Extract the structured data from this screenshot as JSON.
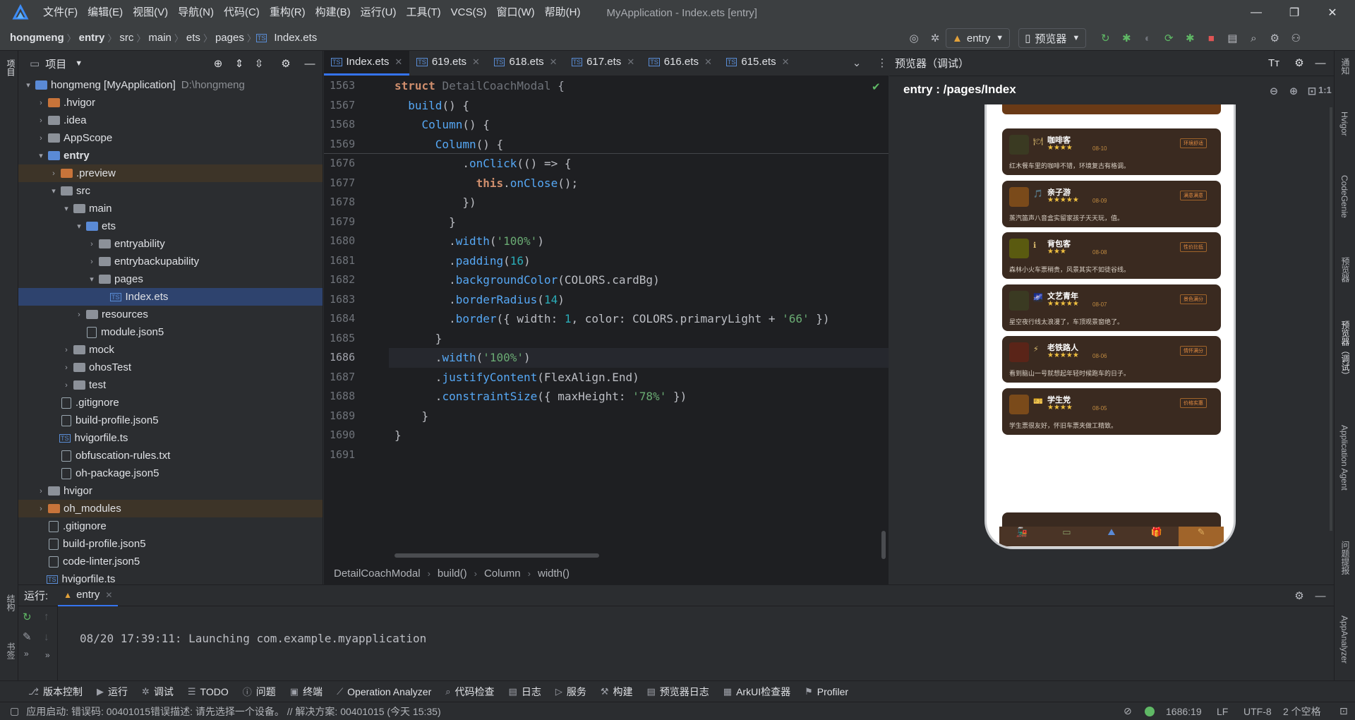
{
  "app": {
    "window_title": "MyApplication - Index.ets [entry]"
  },
  "menu": [
    "文件(F)",
    "编辑(E)",
    "视图(V)",
    "导航(N)",
    "代码(C)",
    "重构(R)",
    "构建(B)",
    "运行(U)",
    "工具(T)",
    "VCS(S)",
    "窗口(W)",
    "帮助(H)"
  ],
  "breadcrumb": [
    "hongmeng",
    "entry",
    "src",
    "main",
    "ets",
    "pages",
    "Index.ets"
  ],
  "toolbar": {
    "run_config": "entry",
    "previewer": "预览器"
  },
  "project_panel": {
    "title": "项目",
    "tree": [
      {
        "label": "hongmeng [MyApplication]",
        "extra": "D:\\hongmeng",
        "depth": 0,
        "arrow": "▾",
        "kind": "folder-blue"
      },
      {
        "label": ".hvigor",
        "depth": 1,
        "arrow": "›",
        "kind": "folder-orange"
      },
      {
        "label": ".idea",
        "depth": 1,
        "arrow": "›",
        "kind": "folder-gray"
      },
      {
        "label": "AppScope",
        "depth": 1,
        "arrow": "›",
        "kind": "folder-gray"
      },
      {
        "label": "entry",
        "depth": 1,
        "arrow": "▾",
        "kind": "folder-blue",
        "bold": true
      },
      {
        "label": ".preview",
        "depth": 2,
        "arrow": "›",
        "kind": "folder-orange",
        "hl": true
      },
      {
        "label": "src",
        "depth": 2,
        "arrow": "▾",
        "kind": "folder-gray"
      },
      {
        "label": "main",
        "depth": 3,
        "arrow": "▾",
        "kind": "folder-gray"
      },
      {
        "label": "ets",
        "depth": 4,
        "arrow": "▾",
        "kind": "folder-blue"
      },
      {
        "label": "entryability",
        "depth": 5,
        "arrow": "›",
        "kind": "folder-gray"
      },
      {
        "label": "entrybackupability",
        "depth": 5,
        "arrow": "›",
        "kind": "folder-gray"
      },
      {
        "label": "pages",
        "depth": 5,
        "arrow": "▾",
        "kind": "folder-gray"
      },
      {
        "label": "Index.ets",
        "depth": 6,
        "arrow": "",
        "kind": "file-ets",
        "selected": true
      },
      {
        "label": "resources",
        "depth": 4,
        "arrow": "›",
        "kind": "folder-gray"
      },
      {
        "label": "module.json5",
        "depth": 4,
        "arrow": "",
        "kind": "file"
      },
      {
        "label": "mock",
        "depth": 3,
        "arrow": "›",
        "kind": "folder-gray"
      },
      {
        "label": "ohosTest",
        "depth": 3,
        "arrow": "›",
        "kind": "folder-gray"
      },
      {
        "label": "test",
        "depth": 3,
        "arrow": "›",
        "kind": "folder-gray"
      },
      {
        "label": ".gitignore",
        "depth": 2,
        "arrow": "",
        "kind": "file"
      },
      {
        "label": "build-profile.json5",
        "depth": 2,
        "arrow": "",
        "kind": "file"
      },
      {
        "label": "hvigorfile.ts",
        "depth": 2,
        "arrow": "",
        "kind": "file-ts"
      },
      {
        "label": "obfuscation-rules.txt",
        "depth": 2,
        "arrow": "",
        "kind": "file"
      },
      {
        "label": "oh-package.json5",
        "depth": 2,
        "arrow": "",
        "kind": "file"
      },
      {
        "label": "hvigor",
        "depth": 1,
        "arrow": "›",
        "kind": "folder-gray"
      },
      {
        "label": "oh_modules",
        "depth": 1,
        "arrow": "›",
        "kind": "folder-orange",
        "hl": true
      },
      {
        "label": ".gitignore",
        "depth": 1,
        "arrow": "",
        "kind": "file"
      },
      {
        "label": "build-profile.json5",
        "depth": 1,
        "arrow": "",
        "kind": "file"
      },
      {
        "label": "code-linter.json5",
        "depth": 1,
        "arrow": "",
        "kind": "file"
      },
      {
        "label": "hvigorfile.ts",
        "depth": 1,
        "arrow": "",
        "kind": "file-ts"
      }
    ]
  },
  "tabs": [
    "Index.ets",
    "619.ets",
    "618.ets",
    "617.ets",
    "616.ets",
    "615.ets"
  ],
  "editor": {
    "line_numbers": [
      "1563",
      "1567",
      "1568",
      "1569",
      "1676",
      "1677",
      "1678",
      "1679",
      "1680",
      "1681",
      "1682",
      "1683",
      "1684",
      "1685",
      "1686",
      "1687",
      "1688",
      "1689",
      "1690",
      "1691"
    ],
    "current_line": "1686",
    "breadcrumb": [
      "DetailCoachModal",
      "build()",
      "Column",
      "width()"
    ]
  },
  "preview": {
    "panel_title": "预览器（调试）",
    "route": "entry : /pages/Index",
    "cards": [
      {
        "name": "咖啡客",
        "stars": "★★★★",
        "date": "08-10",
        "tag": "环境舒适",
        "text": "红木餐车里的咖啡不错，环境复古有格调。",
        "icon": "🍽",
        "color": "#3a3a22"
      },
      {
        "name": "亲子游",
        "stars": "★★★★★",
        "date": "08-09",
        "tag": "满意满意",
        "text": "蒸汽笛声八音盒实留家孩子天天玩，值。",
        "icon": "🎵",
        "color": "#7a4a1a"
      },
      {
        "name": "背包客",
        "stars": "★★★",
        "date": "08-08",
        "tag": "性价比低",
        "text": "森林小火车票稍贵，风景其实不如徒谷线。",
        "icon": "ℹ",
        "color": "#5a5a10"
      },
      {
        "name": "文艺青年",
        "stars": "★★★★★",
        "date": "08-07",
        "tag": "景色满分",
        "text": "星空夜行线太浪漫了，车顶观景窗绝了。",
        "icon": "🌌",
        "color": "#3a3a22"
      },
      {
        "name": "老铁路人",
        "stars": "★★★★★",
        "date": "08-06",
        "tag": "情怀满分",
        "text": "看到脑山一号就想起年轻时候跑车的日子。",
        "icon": "⚡",
        "color": "#5a2418"
      },
      {
        "name": "学生党",
        "stars": "★★★★",
        "date": "08-05",
        "tag": "价格实惠",
        "text": "学生票很友好，怀旧车票夹做工精致。",
        "icon": "🎫",
        "color": "#7a4a1a"
      }
    ]
  },
  "right_strip": [
    "通知",
    "Hvigor",
    "CodeGenie",
    "预览器",
    "预览器（调试）",
    "Application Agent",
    "问题提报",
    "AppAnalyzer"
  ],
  "left_strip": [
    "项目",
    "结构",
    "书签"
  ],
  "run_panel": {
    "label": "运行:",
    "tab": "entry",
    "log": "08/20 17:39:11: Launching com.example.myapplication"
  },
  "bottom_tools": [
    "版本控制",
    "运行",
    "调试",
    "TODO",
    "问题",
    "终端",
    "Operation Analyzer",
    "代码检查",
    "日志",
    "服务",
    "构建",
    "预览器日志",
    "ArkUI检查器",
    "Profiler"
  ],
  "status": {
    "message": "应用启动: 错误码: 00401015错误描述: 请先选择一个设备。 // 解决方案: 00401015 (今天 15:35)",
    "position": "1686:19",
    "line_sep": "LF",
    "encoding": "UTF-8",
    "indent": "2 个空格"
  }
}
